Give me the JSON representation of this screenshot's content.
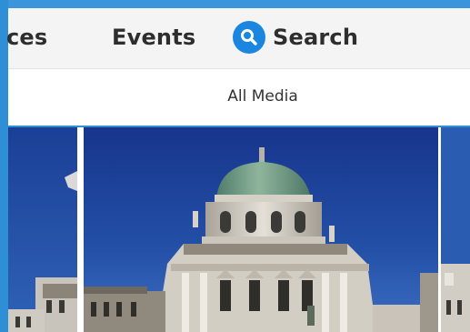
{
  "nav": {
    "places_label": "ces",
    "events_label": "Events",
    "search_label": "Search",
    "search_icon": "search-icon"
  },
  "subbar": {
    "label": "All Media"
  },
  "colors": {
    "frame_blue": "#2f8fd6",
    "search_accent": "#1a86e0",
    "sky_blue": "#1a3f9a",
    "dome_green": "#6a9a80"
  }
}
